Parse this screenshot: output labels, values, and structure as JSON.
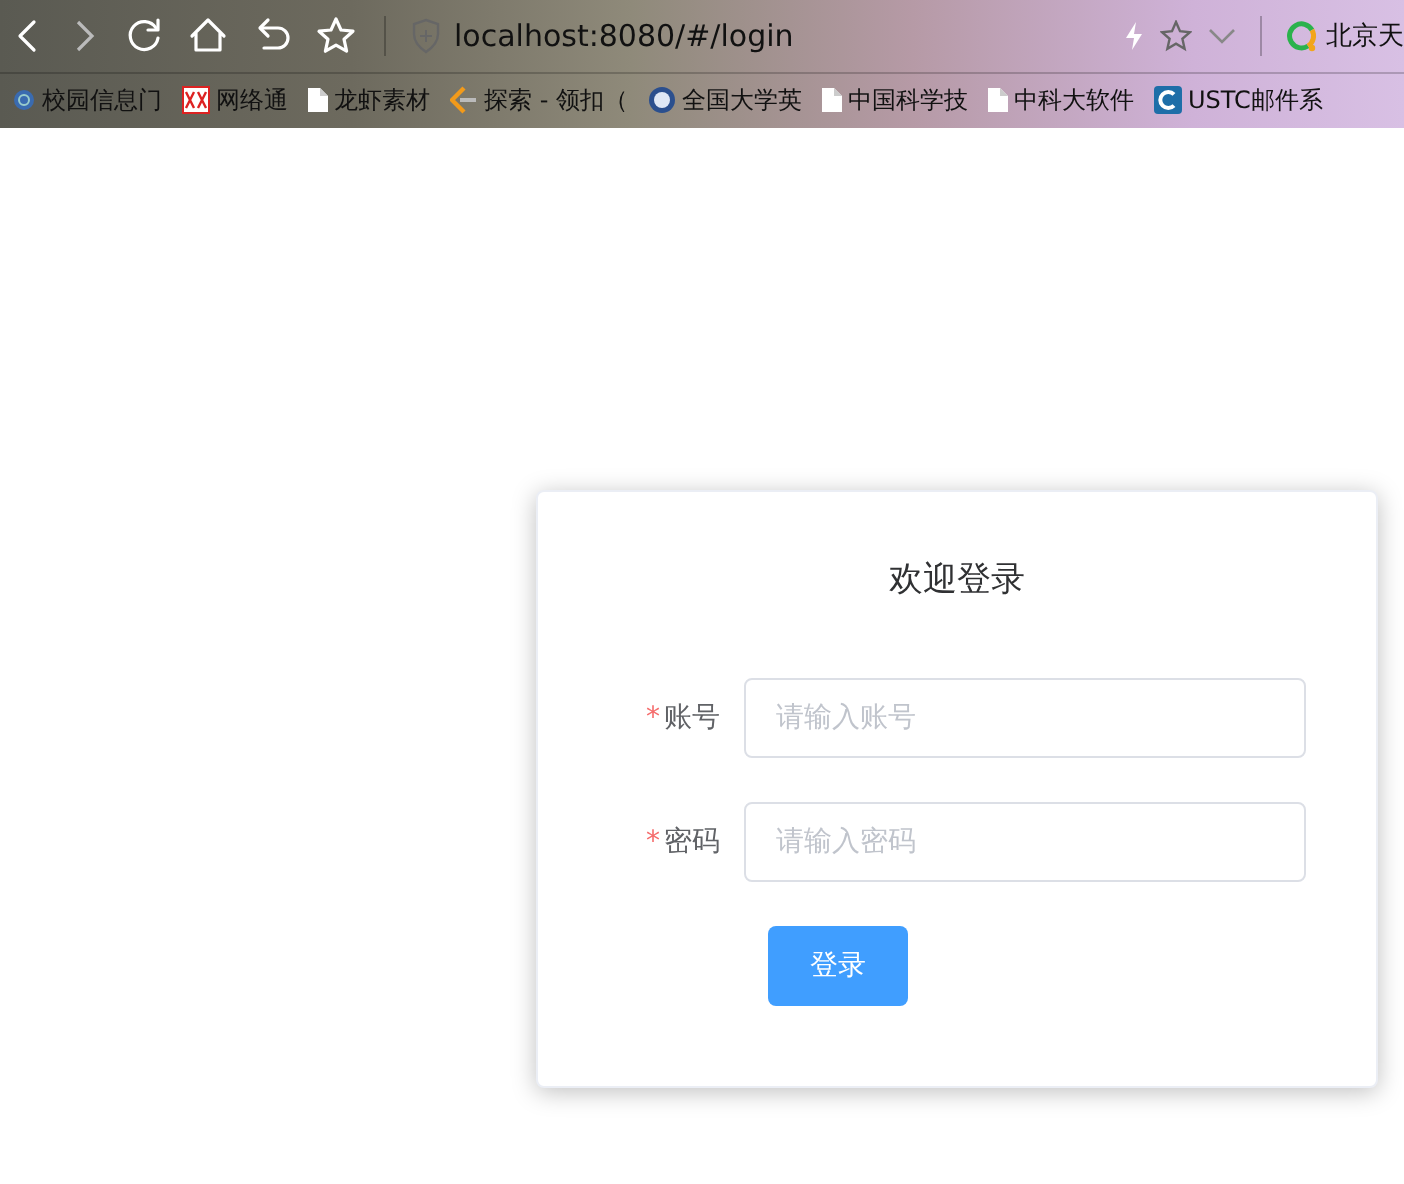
{
  "browser": {
    "address": "localhost:8080/#/login",
    "search_text": "北京天",
    "bookmarks": [
      {
        "label": "校园信息门",
        "kind": "globe"
      },
      {
        "label": "网络通",
        "kind": "mark"
      },
      {
        "label": "龙虾素材",
        "kind": "page"
      },
      {
        "label": "探索 - 领扣（",
        "kind": "arrow"
      },
      {
        "label": "全国大学英",
        "kind": "seal"
      },
      {
        "label": "中国科学技",
        "kind": "page"
      },
      {
        "label": "中科大软件",
        "kind": "page"
      },
      {
        "label": "USTC邮件系",
        "kind": "letter"
      }
    ]
  },
  "login": {
    "title": "欢迎登录",
    "fields": [
      {
        "label": "账号",
        "required": "*",
        "placeholder": "请输入账号"
      },
      {
        "label": "密码",
        "required": "*",
        "placeholder": "请输入密码"
      }
    ],
    "button": "登录"
  }
}
